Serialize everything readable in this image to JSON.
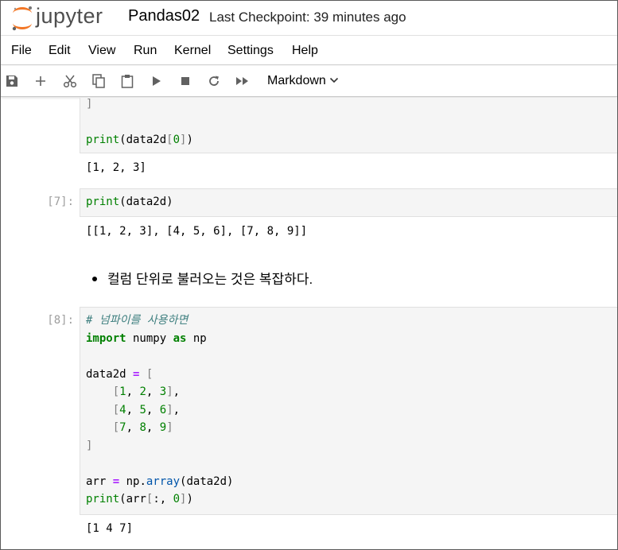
{
  "header": {
    "logo_text": "jupyter",
    "notebook_title": "Pandas02",
    "checkpoint": "Last Checkpoint: 39 minutes ago"
  },
  "menu": [
    "File",
    "Edit",
    "View",
    "Run",
    "Kernel",
    "Settings",
    "Help"
  ],
  "toolbar": {
    "buttons": [
      "save-icon",
      "add-icon",
      "cut-icon",
      "copy-icon",
      "paste-icon",
      "run-icon",
      "stop-icon",
      "restart-icon",
      "fast-forward-icon"
    ],
    "cell_type": "Markdown"
  },
  "cells": {
    "cell_prev": {
      "code_lines": [
        "]",
        "",
        "print(data2d[0])"
      ],
      "output": "[1, 2, 3]"
    },
    "cell7": {
      "prompt": "[7]:",
      "code": "print(data2d)",
      "output": "[[1, 2, 3], [4, 5, 6], [7, 8, 9]]"
    },
    "markdown": {
      "bullet_text": "컬럼 단위로 불러오는 것은 복잡하다."
    },
    "cell8": {
      "prompt": "[8]:",
      "comment": "# 넘파이를 사용하면",
      "output": "[1 4 7]"
    }
  },
  "colors": {
    "keyword": "#008000",
    "operator": "#aa22ff",
    "comment": "#408080",
    "logo_orange": "#f37726"
  }
}
